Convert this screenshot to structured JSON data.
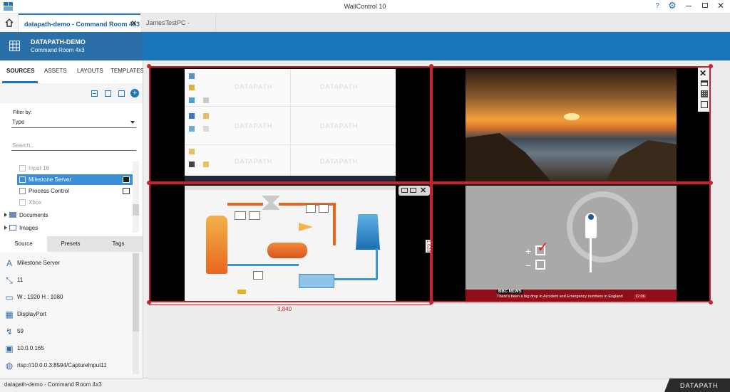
{
  "window": {
    "title": "WallControl 10"
  },
  "tabs": [
    {
      "label": "datapath-demo - Command Room 4x3",
      "active": true
    },
    {
      "label": "JamesTestPC - Blueprint",
      "active": false
    }
  ],
  "header": {
    "title": "DATAPATH-DEMO",
    "subtitle": "Command Room 4x3"
  },
  "sidebar": {
    "tabs": [
      "SOURCES",
      "ASSETS",
      "LAYOUTS",
      "TEMPLATES"
    ],
    "filter_label": "Filter by:",
    "filter_value": "Type",
    "search_placeholder": "Search...",
    "sources": [
      {
        "label": "Input 16",
        "dim": true
      },
      {
        "label": "Milestone Server",
        "selected": true
      },
      {
        "label": "Process Control"
      },
      {
        "label": "Xbox",
        "dim": true
      }
    ],
    "groups": [
      "Documents",
      "Images"
    ],
    "prop_tabs": [
      "Source",
      "Presets",
      "Tags"
    ],
    "properties": [
      {
        "icon": "text-icon",
        "value": "Milestone Server"
      },
      {
        "icon": "shrink-icon",
        "value": "11"
      },
      {
        "icon": "monitor-icon",
        "value": "W : 1920   H : 1080"
      },
      {
        "icon": "displayport-icon",
        "value": "DisplayPort"
      },
      {
        "icon": "refresh-rate-icon",
        "value": "59"
      },
      {
        "icon": "network-icon",
        "value": "10.0.0.165"
      },
      {
        "icon": "globe-icon",
        "value": "rtsp://10.0.0.3:8594/CaptureInput11"
      }
    ]
  },
  "wall": {
    "width_label": "3,840",
    "height_label": "1,620",
    "panes": [
      {
        "name": "pane-desktop",
        "content": "desktop"
      },
      {
        "name": "pane-sunset",
        "content": "sunset"
      },
      {
        "name": "pane-process",
        "content": "process"
      },
      {
        "name": "pane-news",
        "content": "news"
      }
    ],
    "news_logo": "BBC NEWS",
    "news_ticker": "There's been a big drop in Accident and Emergency numbers in England",
    "news_time": "12:06",
    "watermark": "DATAPATH"
  },
  "status": {
    "text": "datapath-demo - Command Room 4x3",
    "brand": "DATAPATH"
  },
  "colors": {
    "accent": "#1b75bb",
    "selection": "#c8212f",
    "list_selected": "#3b8fd6"
  }
}
